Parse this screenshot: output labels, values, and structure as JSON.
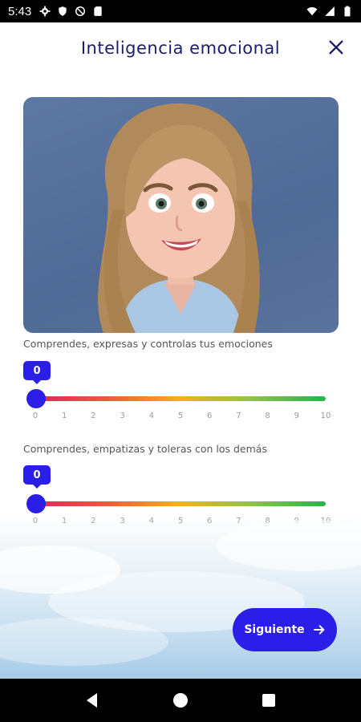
{
  "status_bar": {
    "time": "5:43",
    "left_icons": [
      "gear-icon",
      "shield-icon",
      "no-sync-icon",
      "sd-card-icon"
    ],
    "right_icons": [
      "wifi-icon",
      "signal-icon",
      "battery-icon"
    ]
  },
  "header": {
    "title": "Inteligencia emocional",
    "close_icon": "close-icon"
  },
  "colors": {
    "accent": "#2b1ee8",
    "title": "#1d1d6b",
    "slider_start": "#e0245e",
    "slider_end": "#27b34b"
  },
  "questions": [
    {
      "label": "Comprendes, expresas y controlas tus emociones",
      "value": "0",
      "min": 0,
      "max": 10,
      "ticks": [
        "0",
        "1",
        "2",
        "3",
        "4",
        "5",
        "6",
        "7",
        "8",
        "9",
        "10"
      ]
    },
    {
      "label": "Comprendes, empatizas y toleras con los demás",
      "value": "0",
      "min": 0,
      "max": 10,
      "ticks": [
        "0",
        "1",
        "2",
        "3",
        "4",
        "5",
        "6",
        "7",
        "8",
        "9",
        "10"
      ]
    }
  ],
  "next_button": {
    "label": "Siguiente",
    "icon": "arrow-right-icon"
  },
  "nav_bar": {
    "icons": [
      "back-icon",
      "home-icon",
      "recents-icon"
    ]
  }
}
